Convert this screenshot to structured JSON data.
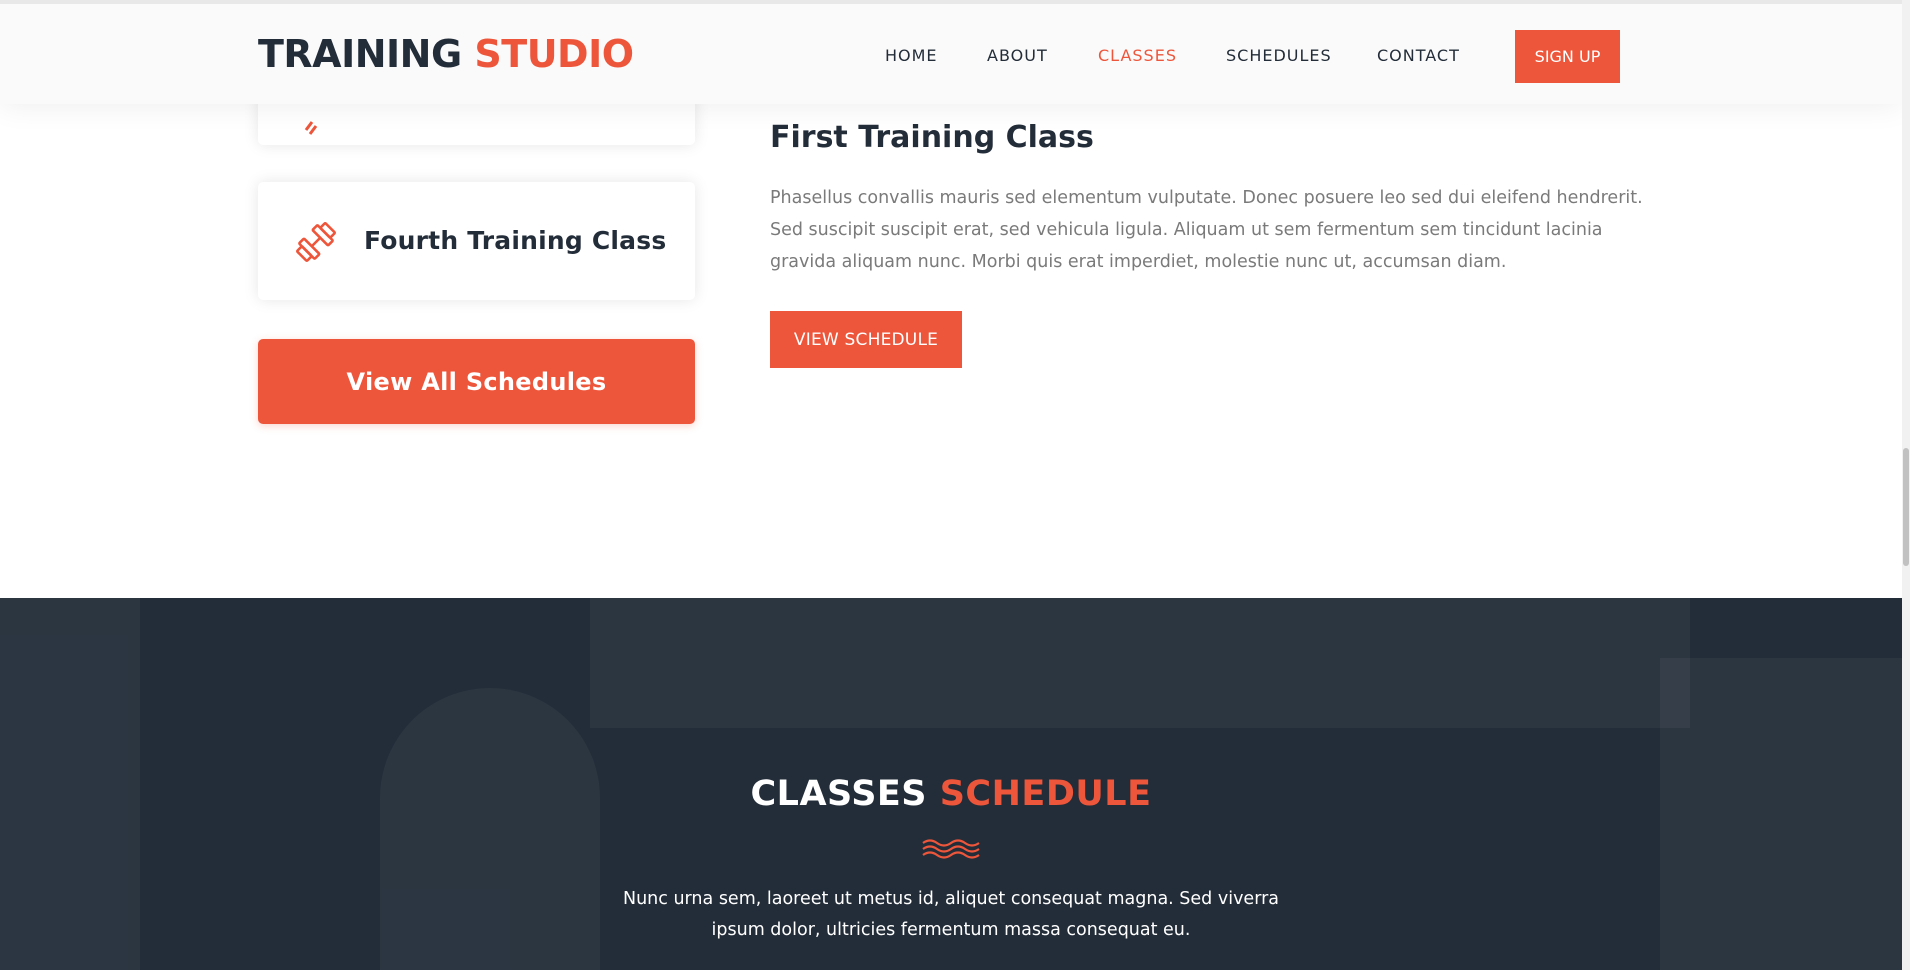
{
  "header": {
    "logo_part1": "TRAINING",
    "logo_part2": "STUDIO",
    "nav": [
      {
        "label": "HOME"
      },
      {
        "label": "ABOUT"
      },
      {
        "label": "CLASSES",
        "active": true
      },
      {
        "label": "SCHEDULES"
      },
      {
        "label": "CONTACT"
      }
    ],
    "signup_label": "SIGN UP"
  },
  "classes": {
    "fourth_label": "Fourth Training Class",
    "view_all_label": "View All Schedules",
    "detail_title": "First Training Class",
    "detail_text": "Phasellus convallis mauris sed elementum vulputate. Donec posuere leo sed dui eleifend hendrerit. Sed suscipit suscipit erat, sed vehicula ligula. Aliquam ut sem fermentum sem tincidunt lacinia gravida aliquam nunc. Morbi quis erat imperdiet, molestie nunc ut, accumsan diam.",
    "view_schedule_label": "VIEW SCHEDULE",
    "icon": "dumbbell-icon"
  },
  "schedule_section": {
    "title_part1": "CLASSES",
    "title_part2": "SCHEDULE",
    "description": "Nunc urna sem, laoreet ut metus id, aliquet consequat magna. Sed viverra ipsum dolor, ultricies fermentum massa consequat eu.",
    "decor_icon": "waves-icon"
  },
  "colors": {
    "accent": "#ed563b",
    "dark": "#232d39",
    "text_muted": "#7a7a7a"
  }
}
